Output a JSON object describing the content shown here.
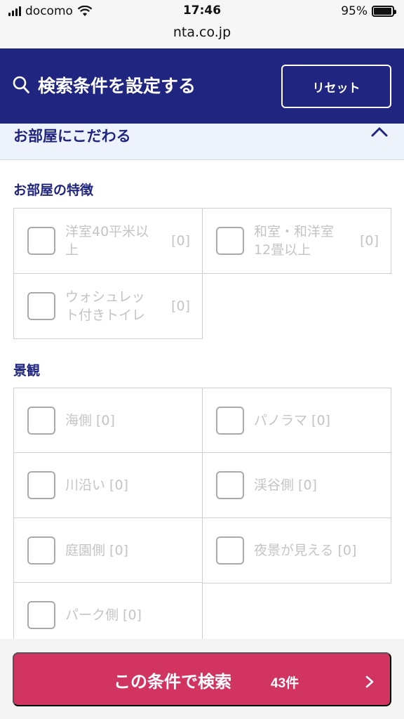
{
  "status_bar": {
    "carrier": "docomo",
    "time": "17:46",
    "battery": "95%",
    "battery_level": 0.95
  },
  "url_bar": {
    "url": "nta.co.jp"
  },
  "header": {
    "title": "検索条件を設定する",
    "reset_label": "リセット"
  },
  "section": {
    "title": "お部屋にこだわる",
    "expanded": true
  },
  "groups": [
    {
      "label": "お部屋の特徴",
      "items": [
        {
          "label_lines": [
            "洋室40平米以",
            "上"
          ],
          "count": "[0]",
          "checked": false
        },
        {
          "label_lines": [
            "和室・和洋室",
            "12畳以上"
          ],
          "count": "[0]",
          "checked": false
        },
        {
          "label_lines": [
            "ウォシュレッ",
            "ト付きトイレ"
          ],
          "count": "[0]",
          "checked": false
        }
      ]
    },
    {
      "label": "景観",
      "items": [
        {
          "label": "海側 [0]",
          "checked": false
        },
        {
          "label": "パノラマ [0]",
          "checked": false
        },
        {
          "label": "川沿い [0]",
          "checked": false
        },
        {
          "label": "渓谷側 [0]",
          "checked": false
        },
        {
          "label": "庭園側 [0]",
          "checked": false
        },
        {
          "label": "夜景が見える [0]",
          "checked": false
        },
        {
          "label": "パーク側 [0]",
          "checked": false
        }
      ]
    }
  ],
  "search_button": {
    "label": "この条件で検索",
    "count": "43件"
  },
  "icons": {
    "search": "search-icon",
    "chevron_up": "chevron-up-icon",
    "chevron_right": "chevron-right-icon",
    "wifi": "wifi-icon",
    "signal": "signal-icon",
    "battery": "battery-icon"
  },
  "colors": {
    "header_bg": "#20267f",
    "accent_text": "#20267f",
    "search_button_bg": "#d23461",
    "disabled_text": "#c4c4c4"
  }
}
